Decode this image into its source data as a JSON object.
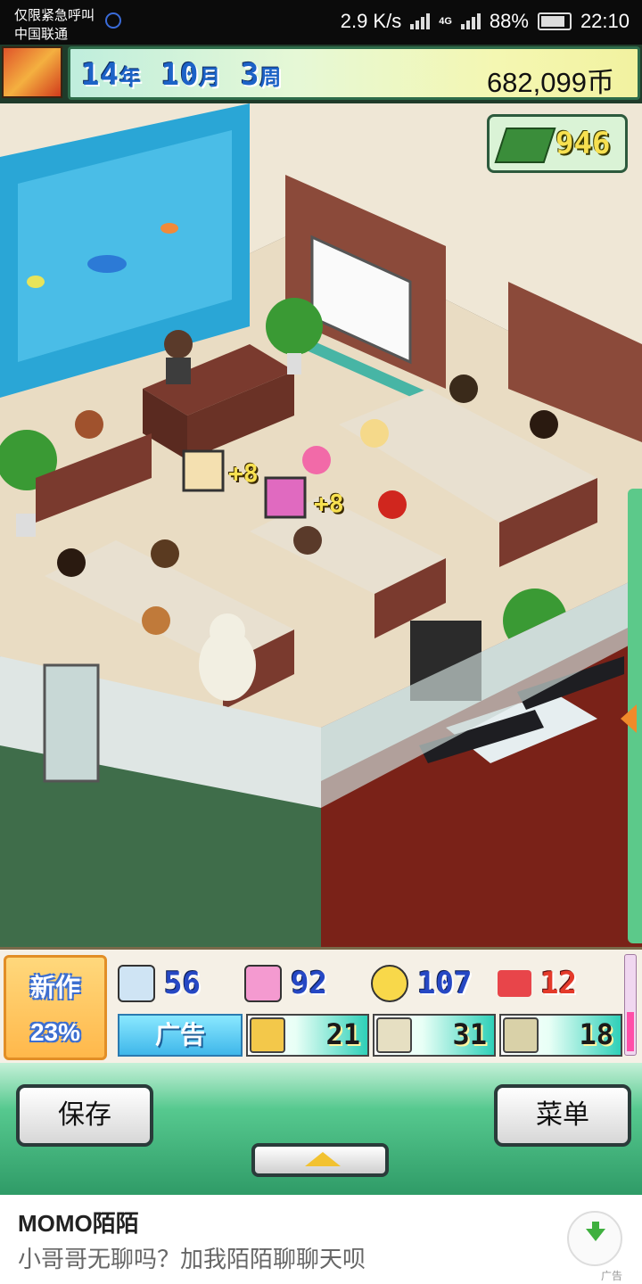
{
  "status_bar": {
    "emergency": "仅限紧急呼叫",
    "carrier": "中国联通",
    "speed": "2.9 K/s",
    "net": "4G",
    "battery": "88%",
    "time": "22:10"
  },
  "top": {
    "year_num": "14",
    "year_unit": "年",
    "month_num": "10",
    "month_unit": "月",
    "week_num": "3",
    "week_unit": "周",
    "money": "682,099币",
    "gems": "946"
  },
  "stats": {
    "new_game_label": "新作",
    "new_game_percent": "23%",
    "fun": "56",
    "creativity": "92",
    "graphics": "107",
    "sound": "12",
    "ad_label": "广告",
    "media": [
      {
        "icon": "film-reel-icon",
        "value": "21"
      },
      {
        "icon": "people-icon",
        "value": "31"
      },
      {
        "icon": "picture-icon",
        "value": "18"
      }
    ]
  },
  "menu": {
    "save": "保存",
    "menu": "菜单"
  },
  "ad": {
    "title": "MOMO陌陌",
    "text": "小哥哥无聊吗？加我陌陌聊聊天呗",
    "tag": "广告"
  },
  "scene": {
    "popups": [
      "+8",
      "+8"
    ]
  },
  "colors": {
    "accent_blue": "#1c63c7",
    "accent_red": "#e43a2a",
    "menu_green": "#2f9b67",
    "ad_blue": "#3fb7ea"
  }
}
